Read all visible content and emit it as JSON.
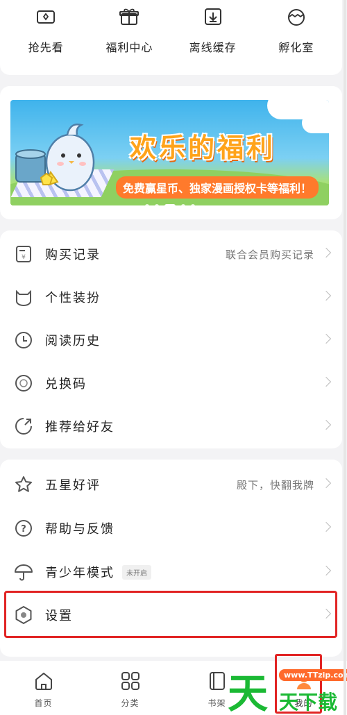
{
  "quick_actions": [
    {
      "label": "抢先看",
      "icon": "ticket-icon"
    },
    {
      "label": "福利中心",
      "icon": "gift-icon"
    },
    {
      "label": "离线缓存",
      "icon": "download-icon"
    },
    {
      "label": "孵化室",
      "icon": "egg-icon"
    }
  ],
  "banner": {
    "title": "欢乐的福利",
    "subtitle": "免费赢星币、独家漫画授权卡等福利！",
    "dots_total": 5,
    "dot_active_index": 2
  },
  "menu_group_1": [
    {
      "label": "购买记录",
      "sub": "联合会员购买记录",
      "icon": "receipt-icon"
    },
    {
      "label": "个性装扮",
      "sub": "",
      "icon": "cat-face-icon"
    },
    {
      "label": "阅读历史",
      "sub": "",
      "icon": "clock-icon"
    },
    {
      "label": "兑换码",
      "sub": "",
      "icon": "redeem-icon"
    },
    {
      "label": "推荐给好友",
      "sub": "",
      "icon": "share-icon"
    }
  ],
  "menu_group_2": [
    {
      "label": "五星好评",
      "sub": "殿下，快翻我牌",
      "icon": "star-icon"
    },
    {
      "label": "帮助与反馈",
      "sub": "",
      "icon": "help-icon"
    },
    {
      "label": "青少年模式",
      "sub": "",
      "badge": "未开启",
      "icon": "umbrella-icon"
    },
    {
      "label": "设置",
      "sub": "",
      "icon": "settings-icon"
    }
  ],
  "tabs": [
    {
      "label": "首页",
      "icon": "home-icon"
    },
    {
      "label": "分类",
      "icon": "grid-icon"
    },
    {
      "label": "书架",
      "icon": "book-icon"
    },
    {
      "label": "我的",
      "icon": "profile-icon"
    }
  ],
  "watermark": {
    "big": "天",
    "pill": "www.TTzip.com",
    "small": "天下载"
  }
}
